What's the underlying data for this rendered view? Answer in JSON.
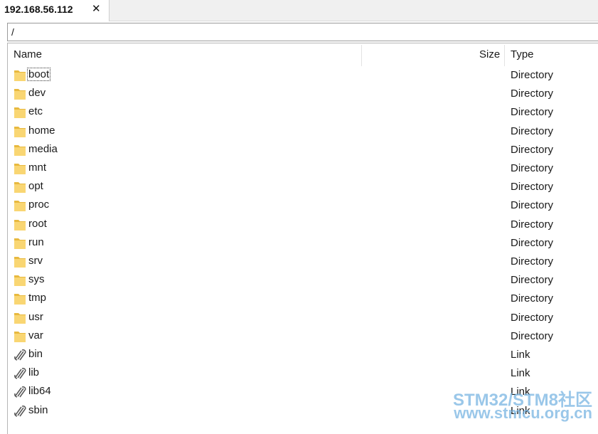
{
  "tab": {
    "title": "192.168.56.112",
    "close_glyph": "✕"
  },
  "path": {
    "value": "/"
  },
  "columns": {
    "name": "Name",
    "size": "Size",
    "type": "Type"
  },
  "files": [
    {
      "name": "boot",
      "size": "",
      "type": "Directory",
      "icon": "folder-icon"
    },
    {
      "name": "dev",
      "size": "",
      "type": "Directory",
      "icon": "folder-icon"
    },
    {
      "name": "etc",
      "size": "",
      "type": "Directory",
      "icon": "folder-icon"
    },
    {
      "name": "home",
      "size": "",
      "type": "Directory",
      "icon": "folder-icon"
    },
    {
      "name": "media",
      "size": "",
      "type": "Directory",
      "icon": "folder-icon"
    },
    {
      "name": "mnt",
      "size": "",
      "type": "Directory",
      "icon": "folder-icon"
    },
    {
      "name": "opt",
      "size": "",
      "type": "Directory",
      "icon": "folder-icon"
    },
    {
      "name": "proc",
      "size": "",
      "type": "Directory",
      "icon": "folder-icon"
    },
    {
      "name": "root",
      "size": "",
      "type": "Directory",
      "icon": "folder-icon"
    },
    {
      "name": "run",
      "size": "",
      "type": "Directory",
      "icon": "folder-icon"
    },
    {
      "name": "srv",
      "size": "",
      "type": "Directory",
      "icon": "folder-icon"
    },
    {
      "name": "sys",
      "size": "",
      "type": "Directory",
      "icon": "folder-icon"
    },
    {
      "name": "tmp",
      "size": "",
      "type": "Directory",
      "icon": "folder-icon"
    },
    {
      "name": "usr",
      "size": "",
      "type": "Directory",
      "icon": "folder-icon"
    },
    {
      "name": "var",
      "size": "",
      "type": "Directory",
      "icon": "folder-icon"
    },
    {
      "name": "bin",
      "size": "",
      "type": "Link",
      "icon": "link-icon"
    },
    {
      "name": "lib",
      "size": "",
      "type": "Link",
      "icon": "link-icon"
    },
    {
      "name": "lib64",
      "size": "",
      "type": "Link",
      "icon": "link-icon"
    },
    {
      "name": "sbin",
      "size": "",
      "type": "Link",
      "icon": "link-icon"
    }
  ],
  "focused_file": "boot",
  "colors": {
    "folder": "#f9d673",
    "folder_dark": "#e8b93f",
    "link": "#555555"
  },
  "watermark": {
    "line1": "STM32/STM8社区",
    "line2": "www.stmcu.org.cn"
  }
}
